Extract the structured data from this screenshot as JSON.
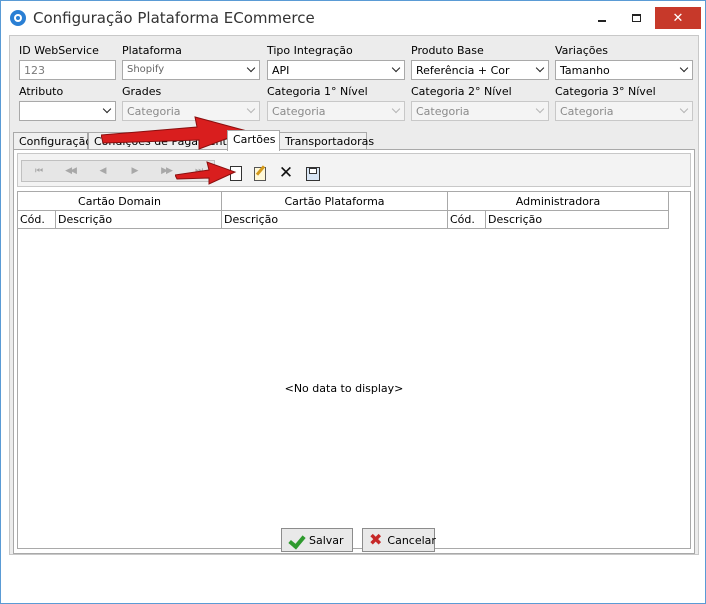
{
  "window": {
    "title": "Configuração Plataforma ECommerce",
    "close_glyph": "✕"
  },
  "form": {
    "id_webservice": {
      "label": "ID WebService",
      "value": "123"
    },
    "plataforma": {
      "label": "Plataforma",
      "value": "Shopify"
    },
    "tipo_integracao": {
      "label": "Tipo Integração",
      "value": "API"
    },
    "produto_base": {
      "label": "Produto Base",
      "value": "Referência + Cor"
    },
    "variacoes": {
      "label": "Variações",
      "value": "Tamanho"
    },
    "atributo": {
      "label": "Atributo",
      "value": ""
    },
    "grades": {
      "label": "Grades",
      "value": "Categoria"
    },
    "categoria_1": {
      "label": "Categoria 1° Nível",
      "value": "Categoria"
    },
    "categoria_2": {
      "label": "Categoria 2° Nível",
      "value": "Categoria"
    },
    "categoria_3": {
      "label": "Categoria 3° Nível",
      "value": "Categoria"
    }
  },
  "tabs": [
    {
      "label": "Configuração"
    },
    {
      "label": "Condições de Pagamento"
    },
    {
      "label": "Cartões"
    },
    {
      "label": "Transportadoras"
    }
  ],
  "navigator": {
    "buttons": [
      "⏮",
      "◀◀",
      "◀",
      "▶",
      "▶▶",
      "⏭"
    ]
  },
  "toolbar": {
    "delete_glyph": "✕"
  },
  "grid": {
    "bands": [
      {
        "label": "Cartão Domain"
      },
      {
        "label": "Cartão Plataforma"
      },
      {
        "label": "Administradora"
      }
    ],
    "columns": [
      {
        "label": "Cód."
      },
      {
        "label": "Descrição"
      },
      {
        "label": "Descrição"
      },
      {
        "label": "Cód."
      },
      {
        "label": "Descrição"
      }
    ],
    "empty_text": "<No data to display>"
  },
  "footer": {
    "save_label": "Salvar",
    "cancel_label": "Cancelar",
    "cancel_glyph": "✖"
  },
  "colors": {
    "arrow": "#d91e1e",
    "close_button": "#c7392a",
    "accent": "#2a7fd4"
  }
}
